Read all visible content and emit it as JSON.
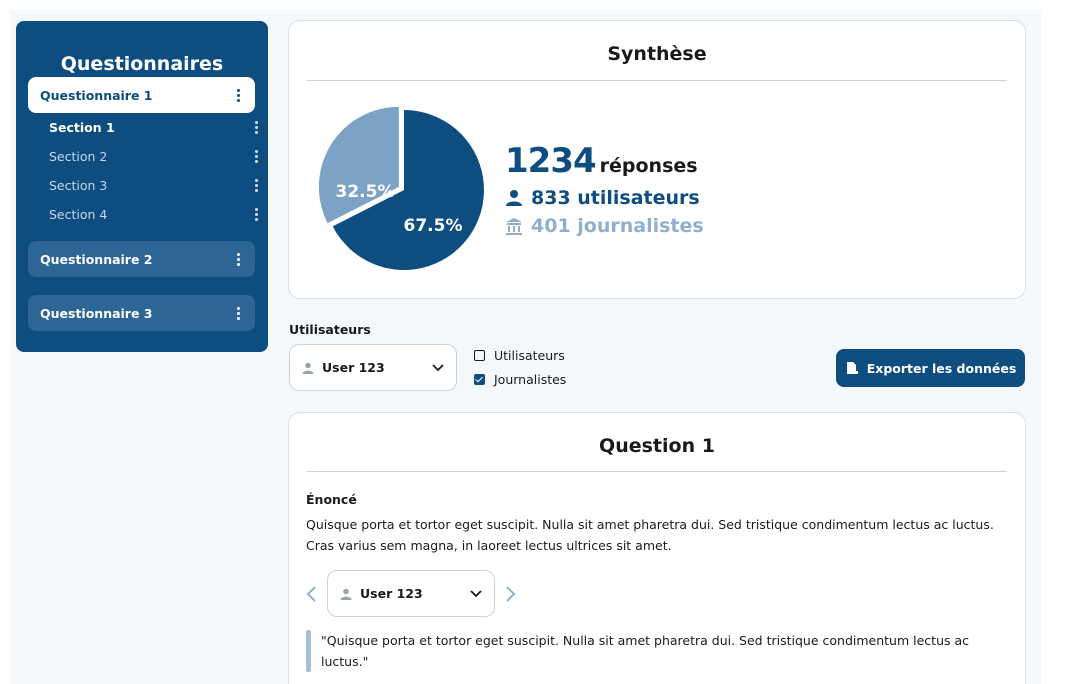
{
  "sidebar": {
    "title": "Questionnaires",
    "questionnaires": [
      {
        "label": "Questionnaire 1",
        "sections": [
          "Section 1",
          "Section 2",
          "Section 3",
          "Section 4"
        ]
      },
      {
        "label": "Questionnaire 2"
      },
      {
        "label": "Questionnaire 3"
      }
    ]
  },
  "synthese": {
    "title": "Synthèse",
    "total": "1234",
    "total_label": "réponses",
    "users_count": "833 utilisateurs",
    "journalists_count": "401 journalistes",
    "pie": {
      "users_percent_label": "67.5%",
      "journalists_percent_label": "32.5%",
      "users_fraction": 0.675,
      "journalists_fraction": 0.325,
      "users_color": "#0e4d80",
      "journalists_color": "#7ca3c5"
    }
  },
  "filters": {
    "label": "Utilisateurs",
    "selected_user": "User 123",
    "checkboxes": [
      {
        "label": "Utilisateurs",
        "checked": false
      },
      {
        "label": "Journalistes",
        "checked": true
      }
    ],
    "export_label": "Exporter les données"
  },
  "question": {
    "title": "Question 1",
    "enonce_label": "Énoncé",
    "enonce_text": "Quisque porta et tortor eget suscipit. Nulla sit amet pharetra dui. Sed tristique condimentum lectus ac luctus. Cras varius sem magna, in laoreet lectus ultrices sit amet.",
    "selected_user": "User 123",
    "answer": "\"Quisque porta et tortor eget suscipit. Nulla sit amet pharetra dui. Sed tristique condimentum lectus ac luctus.\""
  },
  "colors": {
    "primary": "#0e4d80",
    "secondary_light": "#8fb0cd",
    "sidebar_inactive": "#2d6594"
  }
}
